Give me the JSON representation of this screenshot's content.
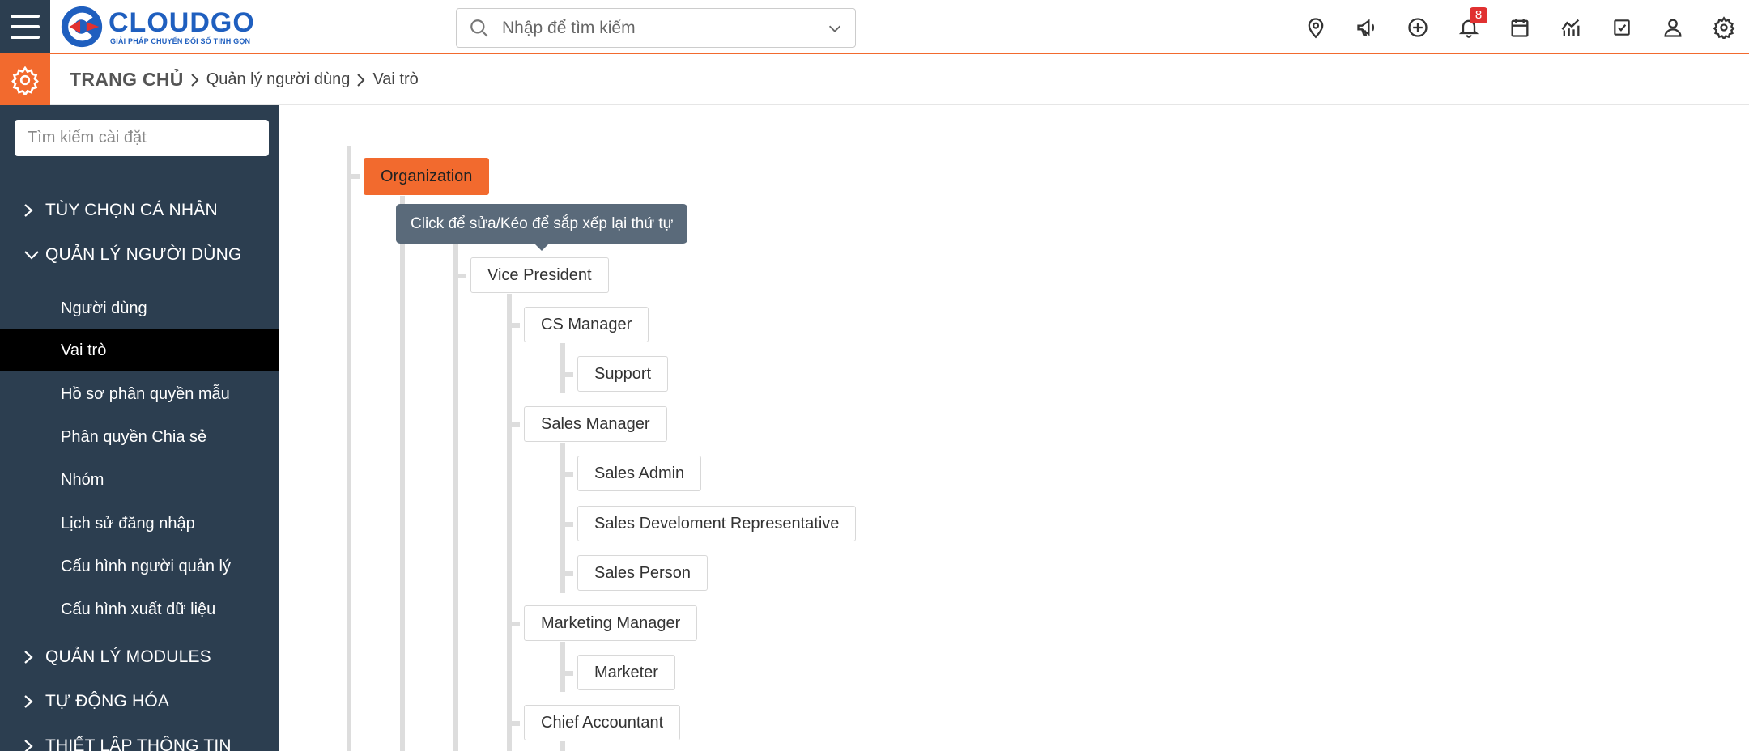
{
  "header": {
    "logo_name": "CLOUDGO",
    "logo_tagline": "GIẢI PHÁP CHUYỂN ĐỔI SỐ TINH GỌN",
    "search_placeholder": "Nhập để tìm kiếm",
    "icons": [
      "location-icon",
      "megaphone-icon",
      "add-circle-icon",
      "bell-icon",
      "calendar-icon",
      "report-icon",
      "task-check-icon",
      "user-icon",
      "settings-icon"
    ],
    "notification_count": "8"
  },
  "breadcrumb": {
    "home": "TRANG CHỦ",
    "level1": "Quản lý người dùng",
    "level2": "Vai trò"
  },
  "sidebar": {
    "search_placeholder": "Tìm kiếm cài đặt",
    "sections": [
      {
        "label": "TÙY CHỌN CÁ NHÂN",
        "expanded": false
      },
      {
        "label": "QUẢN LÝ NGƯỜI DÙNG",
        "expanded": true
      },
      {
        "label": "QUẢN LÝ MODULES",
        "expanded": false
      },
      {
        "label": "TỰ ĐỘNG HÓA",
        "expanded": false
      },
      {
        "label": "THIẾT LẬP THÔNG TIN",
        "expanded": false
      }
    ],
    "items": [
      "Người dùng",
      "Vai trò",
      "Hồ sơ phân quyền mẫu",
      "Phân quyền Chia sẻ",
      "Nhóm",
      "Lịch sử đăng nhập",
      "Cấu hình người quản lý",
      "Cấu hình xuất dữ liệu"
    ],
    "active_item": "Vai trò"
  },
  "tree": {
    "tooltip": "Click để sửa/Kéo để sắp xếp lại thứ tự",
    "root": "Organization",
    "nodes": [
      "Vice President",
      "CS Manager",
      "Support",
      "Sales Manager",
      "Sales Admin",
      "Sales Develoment Representative",
      "Sales Person",
      "Marketing Manager",
      "Marketer",
      "Chief Accountant"
    ]
  },
  "colors": {
    "accent": "#f26a2e",
    "sidebar_bg": "#2c3e50",
    "brand_blue": "#1f5fbf"
  }
}
